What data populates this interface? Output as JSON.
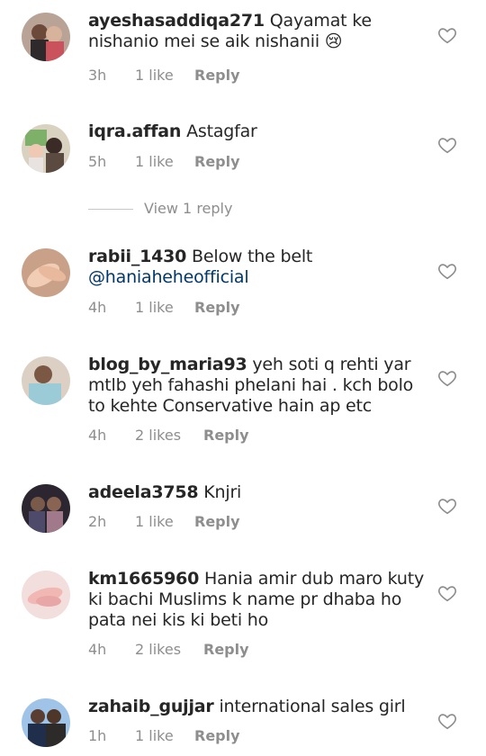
{
  "comments": [
    {
      "username": "ayeshasaddiqa271",
      "text": "Qayamat ke nishanio mei se aik nishanii 😢",
      "mention": "",
      "time": "3h",
      "likes": "1 like",
      "reply": "Reply",
      "avatar_color": "#8a6a55"
    },
    {
      "username": "iqra.affan",
      "text": "Astagfar",
      "mention": "",
      "time": "5h",
      "likes": "1 like",
      "reply": "Reply",
      "avatar_color": "#6f8a5a"
    },
    {
      "username": "rabii_1430",
      "text": "Below the belt",
      "mention": "@haniaheheofficial",
      "time": "4h",
      "likes": "1 like",
      "reply": "Reply",
      "avatar_color": "#d9a88c"
    },
    {
      "username": "blog_by_maria93",
      "text": "yeh soti q rehti yar mtlb yeh fahashi phelani hai . kch bolo to kehte Conservative hain ap etc",
      "mention": "",
      "time": "4h",
      "likes": "2 likes",
      "reply": "Reply",
      "avatar_color": "#a9c9d6"
    },
    {
      "username": "adeela3758",
      "text": "Knjri",
      "mention": "",
      "time": "2h",
      "likes": "1 like",
      "reply": "Reply",
      "avatar_color": "#3b3640"
    },
    {
      "username": "km1665960",
      "text": "Hania amir dub maro kuty ki bachi Muslims k name pr dhaba ho pata nei kis ki beti ho",
      "mention": "",
      "time": "4h",
      "likes": "2 likes",
      "reply": "Reply",
      "avatar_color": "#e8b8b8"
    },
    {
      "username": "zahaib_gujjar",
      "text": "international sales girl",
      "mention": "",
      "time": "1h",
      "likes": "1 like",
      "reply": "Reply",
      "avatar_color": "#4a6fa0"
    }
  ],
  "view_replies": "View 1 reply",
  "icons": {
    "like": "heart-outline-icon"
  },
  "colors": {
    "text": "#262626",
    "secondary": "#8e8e8e",
    "mention": "#00376b"
  }
}
